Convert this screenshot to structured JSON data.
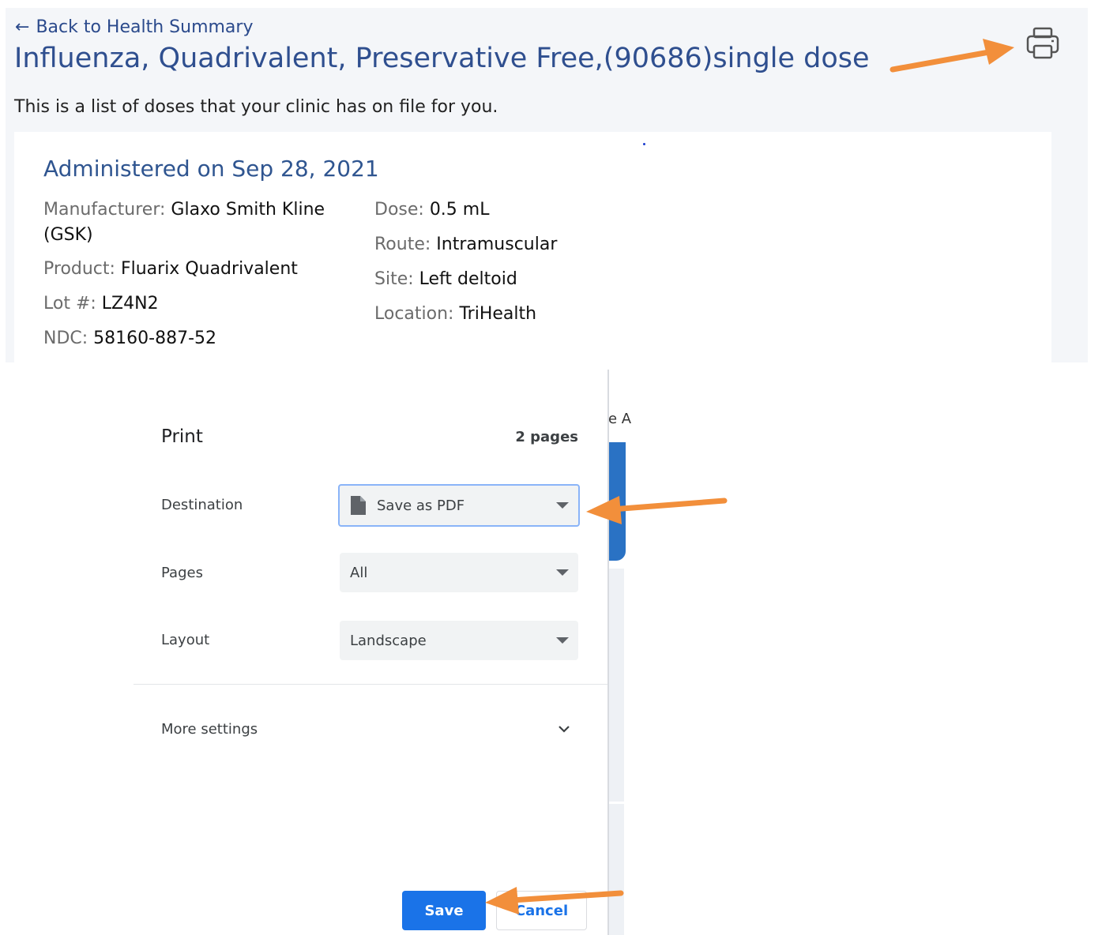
{
  "record": {
    "back_label": "Back to Health Summary",
    "title": "Influenza, Quadrivalent, Preservative Free,(90686)single dose",
    "intro": "This is a list of doses that your clinic has on file for you.",
    "card_title": "Administered on Sep 28, 2021",
    "left_fields": [
      {
        "label": "Manufacturer:",
        "value": "Glaxo Smith Kline (GSK)"
      },
      {
        "label": "Product:",
        "value": "Fluarix Quadrivalent"
      },
      {
        "label": "Lot #:",
        "value": "LZ4N2"
      },
      {
        "label": "NDC:",
        "value": "58160-887-52"
      }
    ],
    "right_fields": [
      {
        "label": "Dose:",
        "value": "0.5 mL"
      },
      {
        "label": "Route:",
        "value": "Intramuscular"
      },
      {
        "label": "Site:",
        "value": "Left deltoid"
      },
      {
        "label": "Location:",
        "value": "TriHealth"
      }
    ]
  },
  "background": {
    "partial_text": "e A"
  },
  "print_dialog": {
    "title": "Print",
    "page_count": "2 pages",
    "destination": {
      "label": "Destination",
      "value": "Save as PDF"
    },
    "pages": {
      "label": "Pages",
      "value": "All"
    },
    "layout": {
      "label": "Layout",
      "value": "Landscape"
    },
    "more_settings": "More settings",
    "save_label": "Save",
    "cancel_label": "Cancel"
  },
  "icons": {
    "back": "arrow-left-icon",
    "print": "printer-icon",
    "file": "file-icon",
    "caret": "caret-down-icon",
    "chevron": "chevron-down-icon"
  },
  "colors": {
    "title_blue": "#2f4f8f",
    "primary_button": "#1a73e8",
    "annotation_arrow": "#f28f3b",
    "panel_bg": "#f4f6f9"
  }
}
